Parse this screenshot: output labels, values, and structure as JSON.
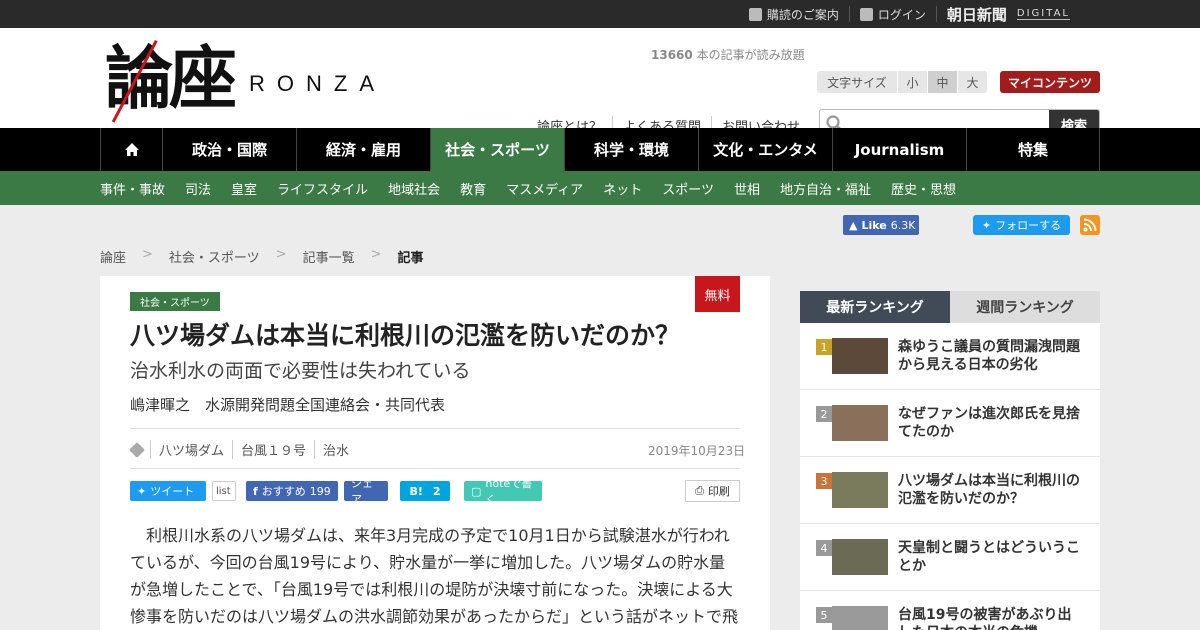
{
  "topbar": {
    "links": [
      "購読のご案内",
      "ログイン"
    ],
    "asahi_logo": "朝日新聞",
    "digital_label": "DIGITAL"
  },
  "header": {
    "logo_kanji": "論座",
    "logo_latin": "RONZA",
    "readable_count": "13660",
    "readable_suffix": " 本の記事が読み放題",
    "fontsize_label": "文字サイズ",
    "fontsize_options": [
      "小",
      "中",
      "大"
    ],
    "fontsize_selected": "中",
    "mycontent_label": "マイコンテンツ",
    "links": [
      "論座とは？",
      "よくある質問",
      "お問い合わせ"
    ],
    "search_placeholder": "",
    "search_button": "検索"
  },
  "mainnav": {
    "items": [
      "政治・国際",
      "経済・雇用",
      "社会・スポーツ",
      "科学・環境",
      "文化・エンタメ",
      "Journalism",
      "特集"
    ],
    "active": "社会・スポーツ"
  },
  "subnav": {
    "items": [
      "事件・事故",
      "司法",
      "皇室",
      "ライフスタイル",
      "地域社会",
      "教育",
      "マスメディア",
      "ネット",
      "スポーツ",
      "世相",
      "地方自治・福祉",
      "歴史・思想"
    ]
  },
  "social_top": {
    "fb_like": "Like",
    "fb_like_count": "6.3K",
    "tw_follow": "フォローする"
  },
  "breadcrumb": {
    "items": [
      "論座",
      "社会・スポーツ",
      "記事一覧"
    ],
    "current": "記事",
    "separator": ">"
  },
  "article": {
    "tag": "社会・スポーツ",
    "free_badge": "無料",
    "title": "八ツ場ダムは本当に利根川の氾濫を防いだのか？",
    "subtitle": "治水利水の両面で必要性は失われている",
    "author": "嶋津暉之　水源開発問題全国連絡会・共同代表",
    "keywords": [
      "八ツ場ダム",
      "台風１９号",
      "治水"
    ],
    "date": "2019年10月23日",
    "share": {
      "tweet": "ツイート",
      "list": "list",
      "fb_recommend": "おすすめ",
      "fb_count": "199",
      "fb_share": "シェア",
      "hatena_label": "B!",
      "hatena_count": "2",
      "note": "noteで書く"
    },
    "print": "印刷",
    "body": "利根川水系の八ツ場ダムは、来年3月完成の予定で10月1日から試験湛水が行われているが、今回の台風19号により、貯水量が一挙に増加した。八ツ場ダムの貯水量が急増したことで、「台風19号では利根川の堤防が決壊寸前になった。決壊による大惨事を防いだのは八ツ場ダムの洪水調節効果があったからだ」という話がネットで飛び"
  },
  "ranking": {
    "tabs": [
      "最新ランキング",
      "週間ランキング"
    ],
    "active_tab": "最新ランキング",
    "items": [
      {
        "rank": "1",
        "title": "森ゆうこ議員の質問漏洩問題から見える日本の劣化"
      },
      {
        "rank": "2",
        "title": "なぜファンは進次郎氏を見捨てたのか"
      },
      {
        "rank": "3",
        "title": "八ツ場ダムは本当に利根川の氾濫を防いだのか？"
      },
      {
        "rank": "4",
        "title": "天皇制と闘うとはどういうことか"
      },
      {
        "rank": "5",
        "title": "台風19号の被害があぶり出した日本の本当の危機"
      }
    ]
  }
}
